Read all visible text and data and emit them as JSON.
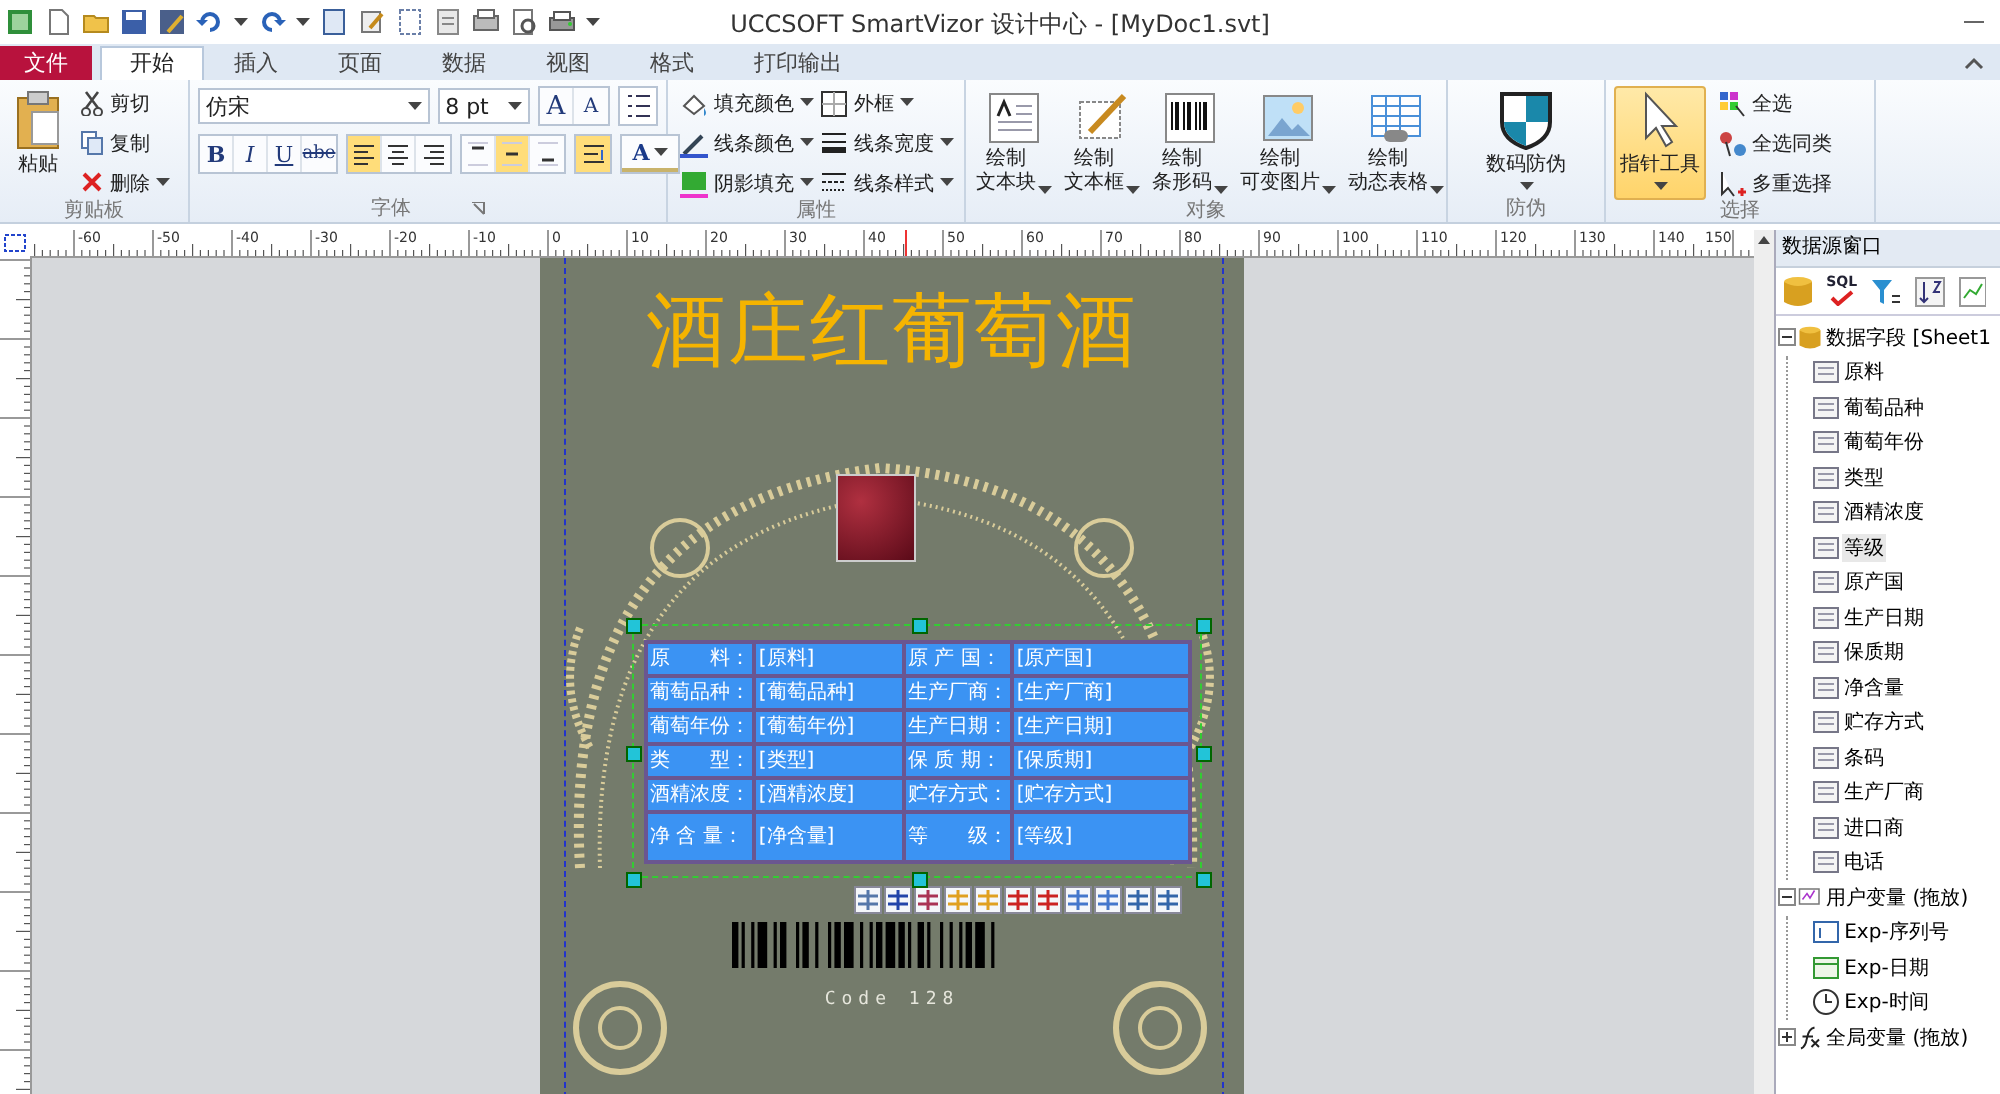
{
  "title_bar": {
    "title": "UCCSOFT SmartVizor 设计中心 - [MyDoc1.svt]"
  },
  "tabs": [
    {
      "label": "文件",
      "kind": "file",
      "selected": false
    },
    {
      "label": "开始",
      "kind": "tab",
      "selected": true
    },
    {
      "label": "插入",
      "kind": "tab",
      "selected": false
    },
    {
      "label": "页面",
      "kind": "tab",
      "selected": false
    },
    {
      "label": "数据",
      "kind": "tab",
      "selected": false
    },
    {
      "label": "视图",
      "kind": "tab",
      "selected": false
    },
    {
      "label": "格式",
      "kind": "tab",
      "selected": false
    },
    {
      "label": "打印输出",
      "kind": "tab",
      "selected": false
    }
  ],
  "clipboard": {
    "caption": "剪贴板",
    "paste": "粘贴",
    "items": [
      {
        "label": "剪切",
        "kind": "cut"
      },
      {
        "label": "复制",
        "kind": "copy"
      },
      {
        "label": "删除",
        "kind": "delete"
      }
    ]
  },
  "font": {
    "caption": "字体",
    "family": "仿宋",
    "size": "8 pt",
    "grow": "A",
    "shrink": "A",
    "color_label": "A",
    "styles": [
      {
        "label": "B",
        "kind": "bold",
        "selected": false
      },
      {
        "label": "I",
        "kind": "italic",
        "selected": false
      },
      {
        "label": "U",
        "kind": "underline",
        "selected": false
      },
      {
        "label": "abe",
        "kind": "strike",
        "selected": false
      }
    ],
    "align": [
      {
        "kind": "left",
        "selected": true
      },
      {
        "kind": "center",
        "selected": false
      },
      {
        "kind": "right",
        "selected": false
      }
    ],
    "valign": [
      {
        "kind": "top",
        "selected": false
      },
      {
        "kind": "middle",
        "selected": true
      },
      {
        "kind": "bottom",
        "selected": false
      }
    ],
    "wrap": {
      "selected": true
    }
  },
  "properties": {
    "caption": "属性",
    "items": [
      {
        "label": "填充颜色",
        "kind": "fill"
      },
      {
        "label": "外框",
        "kind": "border"
      },
      {
        "label": "线条颜色",
        "kind": "line-color"
      },
      {
        "label": "线条宽度",
        "kind": "line-width"
      },
      {
        "label": "阴影填充",
        "kind": "shadow"
      },
      {
        "label": "线条样式",
        "kind": "line-style"
      }
    ]
  },
  "objects": {
    "caption": "对象",
    "items": [
      {
        "lines": [
          "绘制",
          "文本块"
        ],
        "kind": "text-block"
      },
      {
        "lines": [
          "绘制",
          "文本框"
        ],
        "kind": "text-box"
      },
      {
        "lines": [
          "绘制",
          "条形码"
        ],
        "kind": "barcode"
      },
      {
        "lines": [
          "绘制",
          "可变图片"
        ],
        "kind": "image"
      },
      {
        "lines": [
          "绘制",
          "动态表格"
        ],
        "kind": "table"
      }
    ]
  },
  "security": {
    "caption": "防伪",
    "button": "数码防伪"
  },
  "select": {
    "caption": "选择",
    "pointer": {
      "label": "指针工具",
      "selected": true
    },
    "items": [
      {
        "label": "全选",
        "kind": "all"
      },
      {
        "label": "全选同类",
        "kind": "same"
      },
      {
        "label": "多重选择",
        "kind": "multi"
      }
    ]
  },
  "ruler": {
    "labels": [
      "-60",
      "-50",
      "-40",
      "-30",
      "-20",
      "-10",
      "0",
      "10",
      "20",
      "30",
      "40",
      "50",
      "60",
      "70",
      "80",
      "90",
      "100",
      "110",
      "120",
      "130",
      "140",
      "150"
    ]
  },
  "label": {
    "title": "酒庄红葡萄酒",
    "table": {
      "rows": [
        [
          "原　　料：",
          "[原料]",
          "原 产 国：",
          "[原产国]"
        ],
        [
          "葡萄品种：",
          "[葡萄品种]",
          "生产厂商：",
          "[生产厂商]"
        ],
        [
          "葡萄年份：",
          "[葡萄年份]",
          "生产日期：",
          "[生产日期]"
        ],
        [
          "类　　型：",
          "[类型]",
          "保 质 期：",
          "[保质期]"
        ],
        [
          "酒精浓度：",
          "[酒精浓度]",
          "贮存方式：",
          "[贮存方式]"
        ],
        [
          "净 含 量：",
          "[净含量]",
          "等　　级：",
          "[等级]"
        ]
      ]
    },
    "barcode_text": "Code 128"
  },
  "data_panel": {
    "title": "数据源窗口",
    "sql_label": "SQL",
    "tree": [
      {
        "label": "数据字段 [Sheet1",
        "kind": "database",
        "expanded": true,
        "children": [
          {
            "label": "原料",
            "selected": false
          },
          {
            "label": "葡萄品种",
            "selected": false
          },
          {
            "label": "葡萄年份",
            "selected": false
          },
          {
            "label": "类型",
            "selected": false
          },
          {
            "label": "酒精浓度",
            "selected": false
          },
          {
            "label": "等级",
            "selected": true
          },
          {
            "label": "原产国",
            "selected": false
          },
          {
            "label": "生产日期",
            "selected": false
          },
          {
            "label": "保质期",
            "selected": false
          },
          {
            "label": "净含量",
            "selected": false
          },
          {
            "label": "贮存方式",
            "selected": false
          },
          {
            "label": "条码",
            "selected": false
          },
          {
            "label": "生产厂商",
            "selected": false
          },
          {
            "label": "进口商",
            "selected": false
          },
          {
            "label": "电话",
            "selected": false
          }
        ]
      },
      {
        "label": "用户变量 (拖放)",
        "kind": "user",
        "expanded": true,
        "children": [
          {
            "label": "Exp-序列号",
            "kind": "serial",
            "selected": false
          },
          {
            "label": "Exp-日期",
            "kind": "date",
            "selected": false
          },
          {
            "label": "Exp-时间",
            "kind": "time",
            "selected": false
          }
        ]
      },
      {
        "label": "全局变量 (拖放)",
        "kind": "global",
        "expanded": false
      }
    ]
  }
}
